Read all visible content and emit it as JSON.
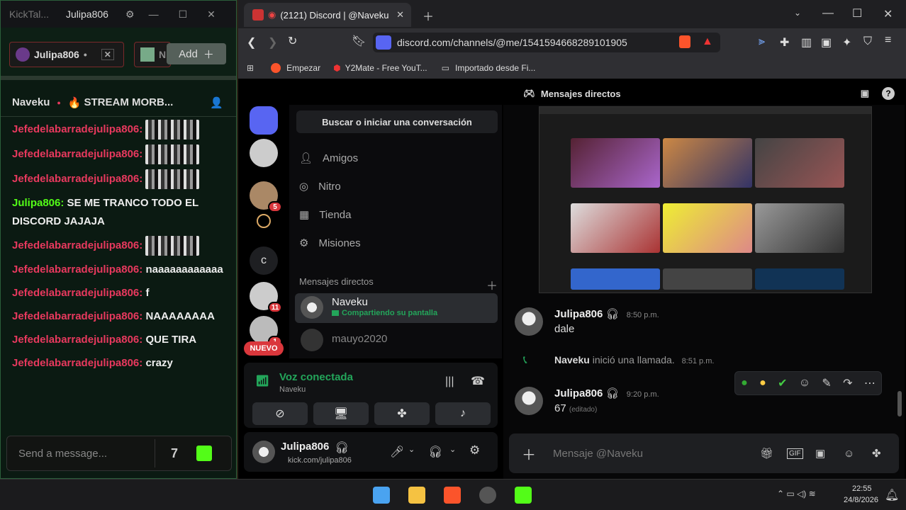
{
  "kick": {
    "app_title": "KickTal...",
    "tab_title": "Julipa806",
    "channels": [
      {
        "label": "Julipa806",
        "dot": "•"
      },
      {
        "label": "N"
      }
    ],
    "add_label": "Add",
    "stream_user": "Naveku",
    "stream_title": "STREAM MORB...",
    "messages": [
      {
        "user": "Jefedelabarradejulipa806:",
        "text": "",
        "emote": true,
        "color": "red"
      },
      {
        "user": "Jefedelabarradejulipa806:",
        "text": "",
        "emote": true,
        "color": "red"
      },
      {
        "user": "Jefedelabarradejulipa806:",
        "text": "",
        "emote": true,
        "color": "red"
      },
      {
        "user": "Julipa806:",
        "text": "SE ME TRANCO TODO EL DISCORD JAJAJA",
        "emote": false,
        "color": "green"
      },
      {
        "user": "Jefedelabarradejulipa806:",
        "text": "",
        "emote": true,
        "color": "red"
      },
      {
        "user": "Jefedelabarradejulipa806:",
        "text": "naaaaaaaaaaaa",
        "emote": false,
        "color": "red"
      },
      {
        "user": "Jefedelabarradejulipa806:",
        "text": "f",
        "emote": false,
        "color": "red"
      },
      {
        "user": "Jefedelabarradejulipa806:",
        "text": "NAAAAAAAA",
        "emote": false,
        "color": "red"
      },
      {
        "user": "Jefedelabarradejulipa806:",
        "text": "QUE TIRA",
        "emote": false,
        "color": "red"
      },
      {
        "user": "Jefedelabarradejulipa806:",
        "text": "crazy",
        "emote": false,
        "color": "red"
      }
    ],
    "send_placeholder": "Send a message..."
  },
  "browser": {
    "tab_title": "(2121) Discord | @Naveku",
    "url": "discord.com/channels/@me/1541594668289101905",
    "bookmarks": [
      "Empezar",
      "Y2Mate - Free YouT...",
      "Importado desde Fi..."
    ]
  },
  "discord": {
    "header": "Mensajes directos",
    "guild_badges": [
      "5",
      "11",
      "1"
    ],
    "guild_letter": "c",
    "new_label": "NUEVO",
    "search": "Buscar o iniciar una conversación",
    "nav": [
      "Amigos",
      "Nitro",
      "Tienda",
      "Misiones"
    ],
    "dm_section": "Mensajes directos",
    "dms": [
      {
        "name": "Naveku",
        "status": "Compartiendo su pantalla"
      },
      {
        "name": "mauyo2020",
        "status": ""
      }
    ],
    "voice_status": "Voz conectada",
    "voice_channel": "Naveku",
    "user_name": "Julipa806",
    "user_status": "kick.com/julipa806",
    "chat": [
      {
        "author": "Julipa806",
        "time": "8:50 p.m.",
        "text": "dale"
      },
      {
        "system": "Naveku",
        "system_text": "inició una llamada.",
        "time": "8:51 p.m."
      },
      {
        "author": "Julipa806",
        "time": "9:20 p.m.",
        "text": "67",
        "edited": "(editado)"
      }
    ],
    "input_placeholder": "Mensaje @Naveku",
    "colors": {
      "accent": "#5865f2",
      "green": "#23a55a",
      "red": "#da373c"
    }
  },
  "taskbar": {
    "time": "22:55",
    "date": "24/8/2026"
  }
}
